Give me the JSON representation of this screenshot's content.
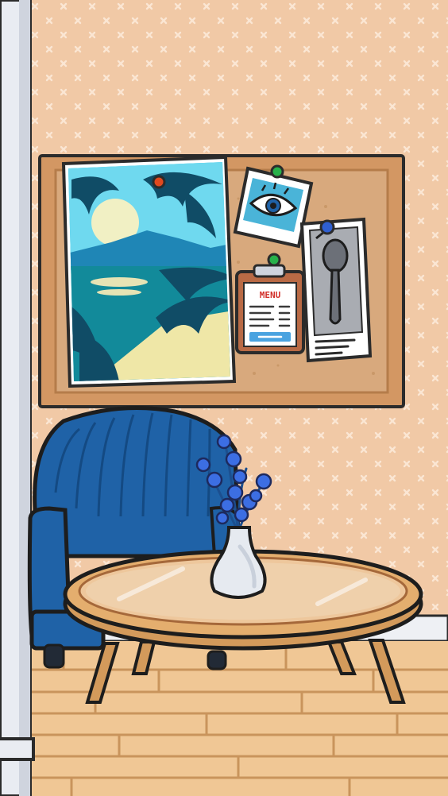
{
  "scene": {
    "room": "living room",
    "objects": [
      "wall-pillar",
      "cork-board",
      "beach-poster",
      "eye-photo",
      "menu-clipboard",
      "spoon-card",
      "blue-armchair",
      "round-table",
      "flower-vase"
    ]
  },
  "cork_board": {
    "menu_card": {
      "title": "MENU"
    }
  },
  "palette": {
    "wall": "#f1c9a6",
    "wall_pattern": "#fbe6d3",
    "frame": "#d39763",
    "cork": "#d8a97d",
    "chair_blue": "#1f62a7",
    "floor": "#f0c795",
    "outline": "#1d1d1d",
    "vase": "#e6eaf0"
  }
}
